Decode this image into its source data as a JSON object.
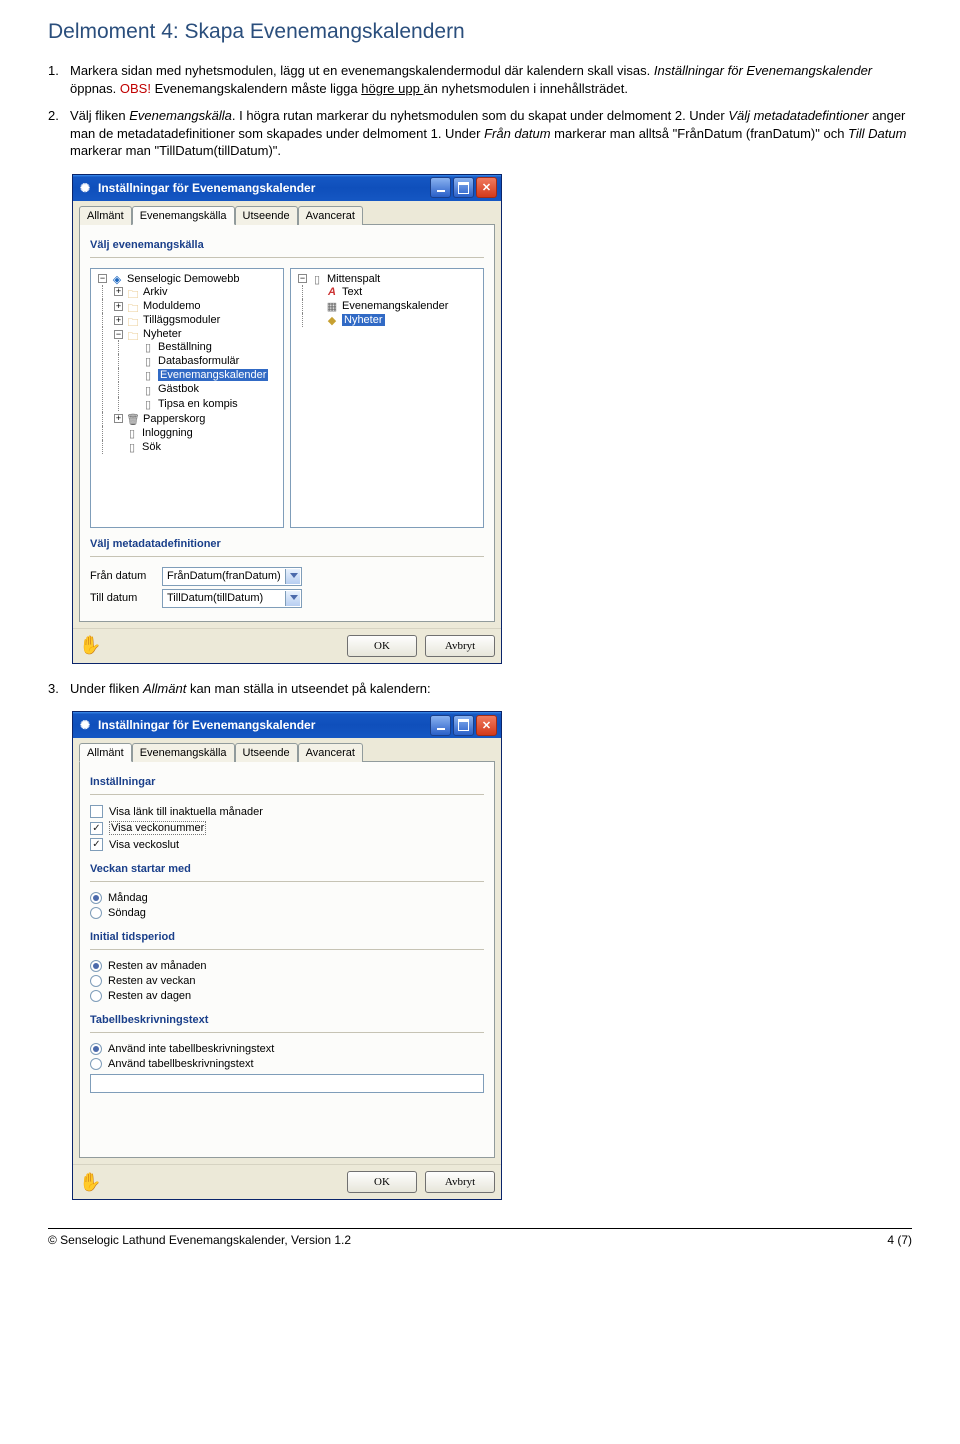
{
  "doc": {
    "title": "Delmoment 4: Skapa Evenemangskalendern",
    "step1_a": "Markera sidan med nyhetsmodulen, lägg ut en evenemangskalendermodul där kalendern skall visas. ",
    "step1_b_em": "Inställningar för Evenemangskalender",
    "step1_c": " öppnas. ",
    "step1_obs": "OBS!",
    "step1_d": " Evenemangskalendern måste ligga ",
    "step1_d_u": "högre upp ",
    "step1_e": "än nyhetsmodulen i innehållsträdet.",
    "step2_a": "Välj fliken ",
    "step2_a_em": "Evenemangskälla",
    "step2_b": ". I högra rutan markerar du nyhetsmodulen som du skapat under delmoment 2. Under ",
    "step2_c_em": "Välj metadatadefintioner",
    "step2_d": " anger man de metadatadefinitioner som skapades under delmoment 1. Under ",
    "step2_e_em": "Från datum",
    "step2_f": " markerar man alltså \"FrånDatum (franDatum)\" och ",
    "step2_g_em": "Till Datum",
    "step2_h": " markerar man \"TillDatum(tillDatum)\".",
    "step3_a": "Under fliken ",
    "step3_a_em": "Allmänt",
    "step3_b": " kan man ställa in utseendet på kalendern:"
  },
  "dlg1": {
    "title": "Inställningar för Evenemangskalender",
    "tabs": [
      "Allmänt",
      "Evenemangskälla",
      "Utseende",
      "Avancerat"
    ],
    "group1": "Välj evenemangskälla",
    "group2": "Välj metadatadefinitioner",
    "from_label": "Från datum",
    "from_value": "FrånDatum(franDatum)",
    "till_label": "Till datum",
    "till_value": "TillDatum(tillDatum)",
    "ok": "OK",
    "cancel": "Avbryt",
    "tree_left": {
      "root": "Senselogic Demowebb",
      "items": [
        "Arkiv",
        "Moduldemo",
        "Tilläggsmoduler",
        "Nyheter"
      ],
      "nyheter_children": [
        "Beställning",
        "Databasformulär",
        "Evenemangskalender",
        "Gästbok",
        "Tipsa en kompis"
      ],
      "after": [
        "Papperskorg",
        "Inloggning",
        "Sök"
      ]
    },
    "tree_right": {
      "root": "Mittenspalt",
      "items": [
        "Text",
        "Evenemangskalender",
        "Nyheter"
      ]
    }
  },
  "dlg2": {
    "title": "Inställningar för Evenemangskalender",
    "tabs": [
      "Allmänt",
      "Evenemangskälla",
      "Utseende",
      "Avancerat"
    ],
    "group1": "Inställningar",
    "chk1": "Visa länk till inaktuella månader",
    "chk2": "Visa veckonummer",
    "chk3": "Visa veckoslut",
    "group2": "Veckan startar med",
    "radio_a1": "Måndag",
    "radio_a2": "Söndag",
    "group3": "Initial tidsperiod",
    "radio_b1": "Resten av månaden",
    "radio_b2": "Resten av veckan",
    "radio_b3": "Resten av dagen",
    "group4": "Tabellbeskrivningstext",
    "radio_c1": "Använd inte tabellbeskrivningstext",
    "radio_c2": "Använd tabellbeskrivningstext",
    "ok": "OK",
    "cancel": "Avbryt"
  },
  "footer": {
    "left": "© Senselogic Lathund Evenemangskalender, Version 1.2",
    "right": "4 (7)"
  }
}
